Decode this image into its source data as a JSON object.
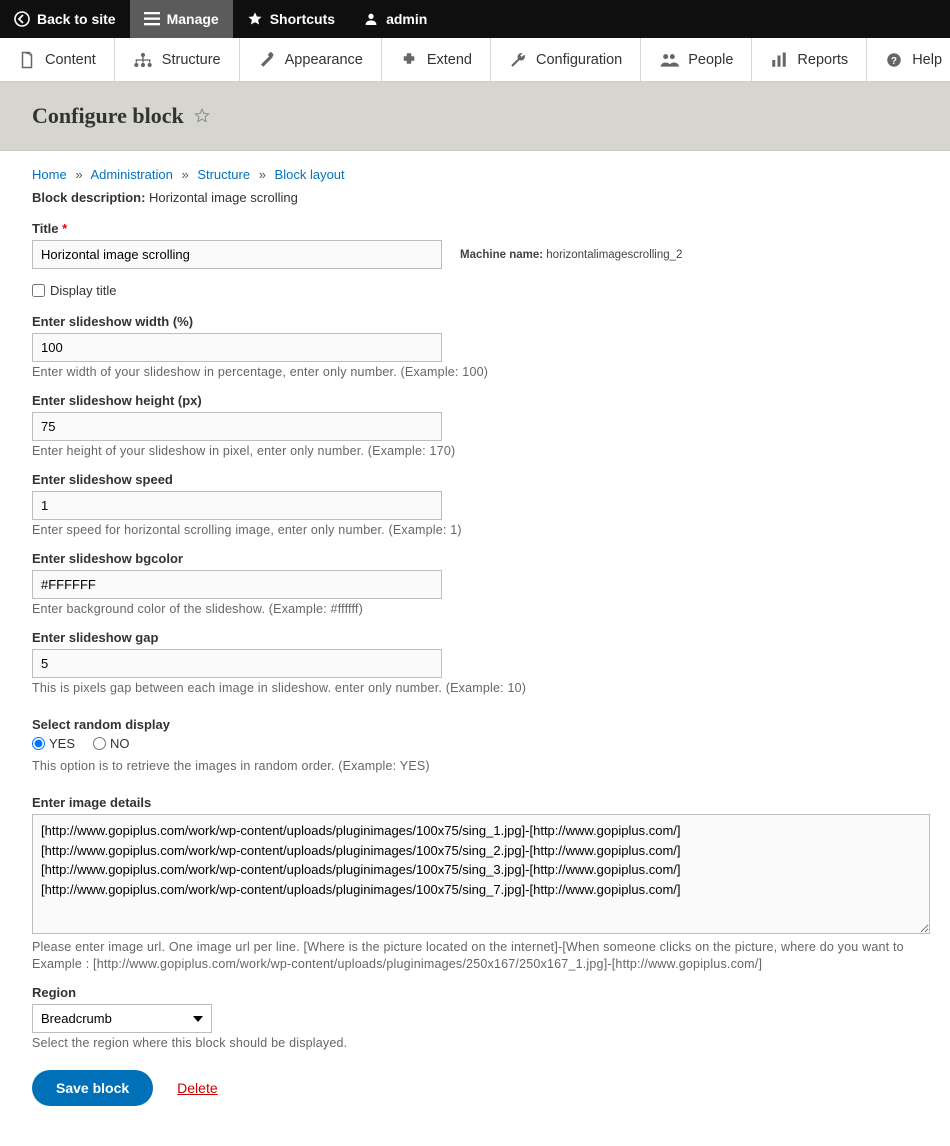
{
  "toolbar": {
    "back": "Back to site",
    "manage": "Manage",
    "shortcuts": "Shortcuts",
    "admin": "admin"
  },
  "admin_menu": {
    "content": "Content",
    "structure": "Structure",
    "appearance": "Appearance",
    "extend": "Extend",
    "configuration": "Configuration",
    "people": "People",
    "reports": "Reports",
    "help": "Help"
  },
  "page_title": "Configure block",
  "breadcrumb": {
    "home": "Home",
    "admin": "Administration",
    "structure": "Structure",
    "block": "Block layout"
  },
  "block_desc_label": "Block description:",
  "block_desc_value": "Horizontal image scrolling",
  "form": {
    "title_label": "Title",
    "title_value": "Horizontal image scrolling",
    "machine_label": "Machine name:",
    "machine_value": "horizontalimagescrolling_2",
    "display_title_label": "Display title",
    "width_label": "Enter slideshow width (%)",
    "width_value": "100",
    "width_help": "Enter width of your slideshow in percentage, enter only number. (Example: 100)",
    "height_label": "Enter slideshow height (px)",
    "height_value": "75",
    "height_help": "Enter height of your slideshow in pixel, enter only number. (Example: 170)",
    "speed_label": "Enter slideshow speed",
    "speed_value": "1",
    "speed_help": "Enter speed for horizontal scrolling image, enter only number. (Example: 1)",
    "bgcolor_label": "Enter slideshow bgcolor",
    "bgcolor_value": "#FFFFFF",
    "bgcolor_help": "Enter background color of the slideshow. (Example: #ffffff)",
    "gap_label": "Enter slideshow gap",
    "gap_value": "5",
    "gap_help": "This is pixels gap between each image in slideshow. enter only number. (Example: 10)",
    "random_label": "Select random display",
    "random_yes": "YES",
    "random_no": "NO",
    "random_help": "This option is to retrieve the images in random order. (Example: YES)",
    "details_label": "Enter image details",
    "details_value": "[http://www.gopiplus.com/work/wp-content/uploads/pluginimages/100x75/sing_1.jpg]-[http://www.gopiplus.com/]\n[http://www.gopiplus.com/work/wp-content/uploads/pluginimages/100x75/sing_2.jpg]-[http://www.gopiplus.com/]\n[http://www.gopiplus.com/work/wp-content/uploads/pluginimages/100x75/sing_3.jpg]-[http://www.gopiplus.com/]\n[http://www.gopiplus.com/work/wp-content/uploads/pluginimages/100x75/sing_7.jpg]-[http://www.gopiplus.com/]",
    "details_help1": "Please enter image url. One image url per line. [Where is the picture located on the internet]-[When someone clicks on the picture, where do you want to",
    "details_help2": "Example : [http://www.gopiplus.com/work/wp-content/uploads/pluginimages/250x167/250x167_1.jpg]-[http://www.gopiplus.com/]",
    "region_label": "Region",
    "region_value": "Breadcrumb",
    "region_help": "Select the region where this block should be displayed."
  },
  "actions": {
    "save": "Save block",
    "delete": "Delete"
  }
}
